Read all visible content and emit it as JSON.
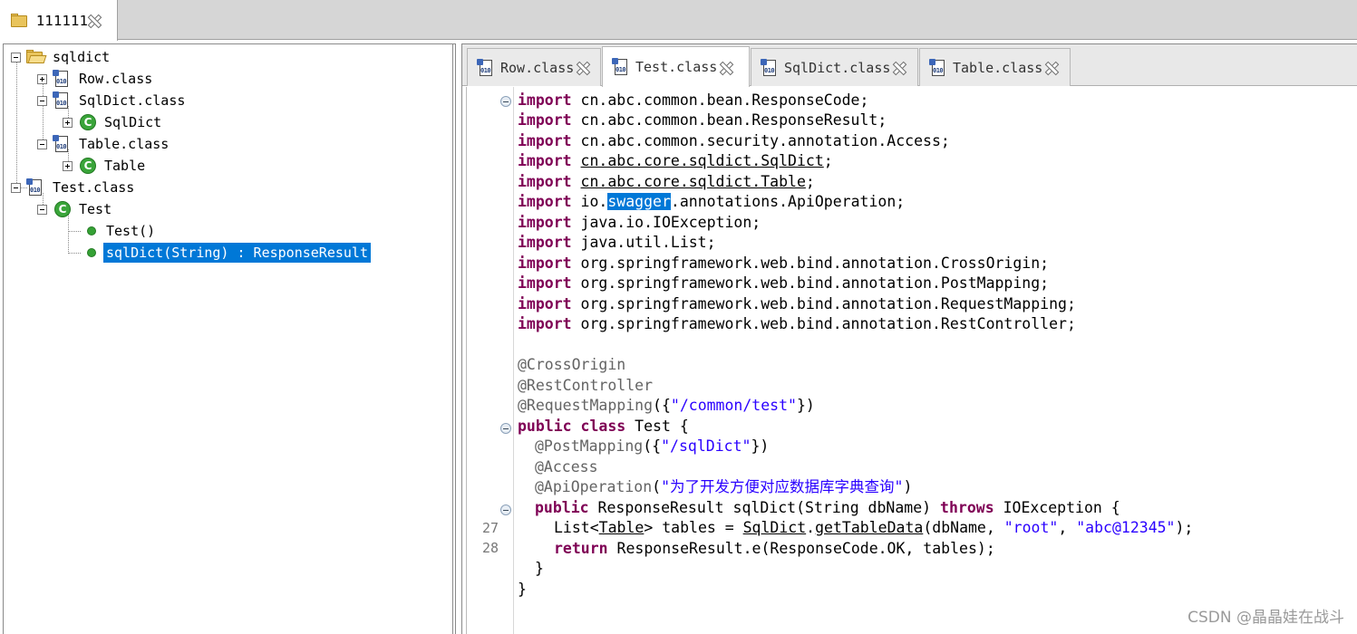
{
  "top_tab": {
    "label": "111111"
  },
  "tree": {
    "nodes": [
      {
        "label": "sqldict"
      },
      {
        "label": "Row.class"
      },
      {
        "label": "SqlDict.class"
      },
      {
        "label": "SqlDict"
      },
      {
        "label": "Table.class"
      },
      {
        "label": "Table"
      },
      {
        "label": "Test.class"
      },
      {
        "label": "Test"
      },
      {
        "label": "Test()"
      },
      {
        "label": "sqlDict(String) : ResponseResult"
      }
    ]
  },
  "editor": {
    "tabs": [
      {
        "label": "Row.class"
      },
      {
        "label": "Test.class"
      },
      {
        "label": "SqlDict.class"
      },
      {
        "label": "Table.class"
      }
    ],
    "active_tab": "Test.class",
    "line_numbers": [
      "27",
      "28"
    ],
    "code": {
      "l1": [
        "import",
        " cn.abc.common.bean.ResponseCode;"
      ],
      "l2": [
        "import",
        " cn.abc.common.bean.ResponseResult;"
      ],
      "l3": [
        "import",
        " cn.abc.common.security.annotation.Access;"
      ],
      "l4": [
        "import",
        "cn.abc.core.sqldict.SqlDict",
        ";"
      ],
      "l5": [
        "import",
        "cn.abc.core.sqldict.Table",
        ";"
      ],
      "l6": [
        "import",
        " io.",
        "swagger",
        ".annotations.ApiOperation;"
      ],
      "l7": [
        "import",
        " java.io.IOException;"
      ],
      "l8": [
        "import",
        " java.util.List;"
      ],
      "l9": [
        "import",
        " org.springframework.web.bind.annotation.CrossOrigin;"
      ],
      "l10": [
        "import",
        " org.springframework.web.bind.annotation.PostMapping;"
      ],
      "l11": [
        "import",
        " org.springframework.web.bind.annotation.RequestMapping;"
      ],
      "l12": [
        "import",
        " org.springframework.web.bind.annotation.RestController;"
      ],
      "l13": "@CrossOrigin",
      "l14": "@RestController",
      "l15": [
        "@RequestMapping",
        "({",
        "\"/common/test\"",
        "})"
      ],
      "l16": [
        "public",
        "class",
        " Test {"
      ],
      "l17": [
        "@PostMapping",
        "({",
        "\"/sqlDict\"",
        "})"
      ],
      "l18": "@Access",
      "l19": [
        "@ApiOperation",
        "(",
        "\"为了开发方便对应数据库字典查询\"",
        ")"
      ],
      "l20": [
        "public",
        " ResponseResult sqlDict(String dbName) ",
        "throws",
        " IOException {"
      ],
      "l21": [
        "List<",
        "Table",
        "> tables = ",
        "SqlDict",
        ".",
        "getTableData",
        "(dbName, ",
        "\"root\"",
        ", ",
        "\"abc@12345\"",
        ");"
      ],
      "l22": [
        "return",
        " ResponseResult.e(ResponseCode.OK, tables);"
      ],
      "l23": "}",
      "l24": "}"
    }
  },
  "watermark": "CSDN @晶晶娃在战斗"
}
